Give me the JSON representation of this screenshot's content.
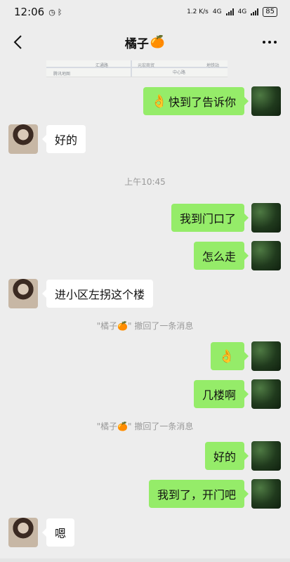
{
  "status": {
    "time": "12:06",
    "net_speed": "1.2 K/s",
    "network1": "4G",
    "network2": "4G",
    "battery": "85"
  },
  "header": {
    "title": "橘子",
    "title_emoji": "🍊"
  },
  "timestamp": "上午10:45",
  "messages": [
    {
      "side": "right",
      "text": "快到了告诉你",
      "emoji": "👌"
    },
    {
      "side": "left",
      "text": "好的"
    },
    {
      "side": "right",
      "text": "我到门口了"
    },
    {
      "side": "right",
      "text": "怎么走"
    },
    {
      "side": "left",
      "text": "进小区左拐这个楼"
    },
    {
      "side": "right",
      "text": "",
      "emoji": "👌"
    },
    {
      "side": "right",
      "text": "几楼啊"
    },
    {
      "side": "right",
      "text": "好的"
    },
    {
      "side": "right",
      "text": "我到了，开门吧"
    },
    {
      "side": "left",
      "text": "嗯"
    }
  ],
  "recall_notice": "\"橘子🍊\" 撤回了一条消息",
  "map_labels": [
    "腾讯地图",
    "汇通路",
    "元宏商贸",
    "中心路",
    "地铁站"
  ]
}
